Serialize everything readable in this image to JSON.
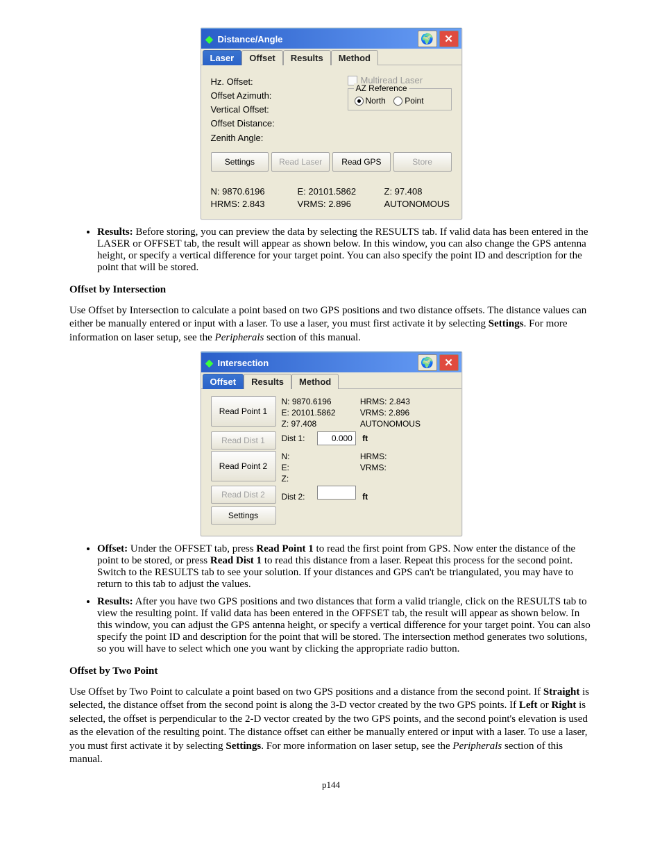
{
  "dialog1": {
    "title": "Distance/Angle",
    "tabs": [
      "Laser",
      "Offset",
      "Results",
      "Method"
    ],
    "activeTab": 0,
    "labels": {
      "hz": "Hz. Offset:",
      "azimuth": "Offset Azimuth:",
      "vertical": "Vertical Offset:",
      "distance": "Offset Distance:",
      "zenith": "Zenith Angle:"
    },
    "checkbox": "Multiread Laser",
    "groupTitle": "AZ Reference",
    "radio": {
      "north": "North",
      "point": "Point",
      "selected": "north"
    },
    "buttons": {
      "settings": "Settings",
      "readLaser": "Read Laser",
      "readGps": "Read GPS",
      "store": "Store"
    },
    "status": {
      "n": "N: 9870.6196",
      "e": "E: 20101.5862",
      "z": "Z:  97.408",
      "hrms": "HRMS: 2.843",
      "vrms": "VRMS:  2.896",
      "mode": "AUTONOMOUS"
    }
  },
  "para1": {
    "lead": "Results:",
    "body": " Before storing, you can preview the data by selecting the RESULTS tab. If valid data has been entered in the LASER or OFFSET tab, the result will appear as shown below. In this window, you can also change the GPS antenna height, or specify a vertical difference for your target point. You can also specify the point ID and description for the point that will be stored."
  },
  "sectionIntersection": {
    "title": "Offset by Intersection",
    "body1": "Use Offset by Intersection to calculate a point based on two GPS positions and two distance offsets. The distance values can either be manually entered or input with a laser. To use a laser, you must first activate it by selecting ",
    "bold1": "Settings",
    "body2": ". For more information on laser setup, see the ",
    "ital1": "Peripherals",
    "body3": " section of this manual."
  },
  "dialog2": {
    "title": "Intersection",
    "tabs": [
      "Offset",
      "Results",
      "Method"
    ],
    "activeTab": 0,
    "readPoint1": "Read Point 1",
    "readDist1": "Read Dist 1",
    "readPoint2": "Read Point 2",
    "readDist2": "Read Dist 2",
    "settings": "Settings",
    "p1": {
      "n": "N:  9870.6196",
      "e": "E:  20101.5862",
      "z": "Z:  97.408",
      "hrms": "HRMS: 2.843",
      "vrms": "VRMS: 2.896",
      "mode": "AUTONOMOUS"
    },
    "dist1": {
      "label": "Dist 1:",
      "val": "0.000",
      "unit": "ft"
    },
    "p2": {
      "n": "N:",
      "e": "E:",
      "z": "Z:",
      "hrms": "HRMS:",
      "vrms": "VRMS:"
    },
    "dist2": {
      "label": "Dist 2:",
      "val": "",
      "unit": "ft"
    }
  },
  "afterD2": {
    "offset": {
      "lead": "Offset:",
      "body": " Under the OFFSET tab, press ",
      "b1": "Read Point 1",
      "body2": " to read the first point from GPS. Now enter the distance of the point to be stored, or press ",
      "b2": "Read Dist 1",
      "body3": " to read this distance from a laser. Repeat this process for the second point. Switch to the RESULTS tab to see your solution. If your distances and GPS can't be triangulated, you may have to return to this tab to adjust the values."
    },
    "results": {
      "lead": "Results:",
      "body": " After you have two GPS positions and two distances that form a valid triangle, click on the RESULTS tab to view the resulting point. If valid data has been entered in the OFFSET tab, the result will appear as shown below. In this window, you can adjust the GPS antenna height, or specify a vertical difference for your target point. You can also specify the point ID and description for the point that will be stored. The intersection method generates two solutions, so you will have to select which one you want by clicking the appropriate radio button."
    }
  },
  "sectionTwoPoint": {
    "title": "Offset by Two Point",
    "body1": "Use Offset by Two Point to calculate a point based on two GPS positions and a distance from the second point. If ",
    "b1": "Straight",
    "body2": " is selected, the distance offset from the second point is along the 3-D vector created by the two GPS points. If ",
    "b2": "Left",
    "body3": " or ",
    "b3": "Right",
    "body4": " is selected, the offset is perpendicular to the 2-D vector created by the two GPS points, and the second point's elevation is used as the elevation of the resulting point. The distance offset can either be manually entered or input with a laser. To use a laser, you must first activate it by selecting ",
    "b4": "Settings",
    "body5": ". For more information on laser setup, see the ",
    "i1": "Peripherals",
    "body6": " section of this manual."
  },
  "page": "p144"
}
